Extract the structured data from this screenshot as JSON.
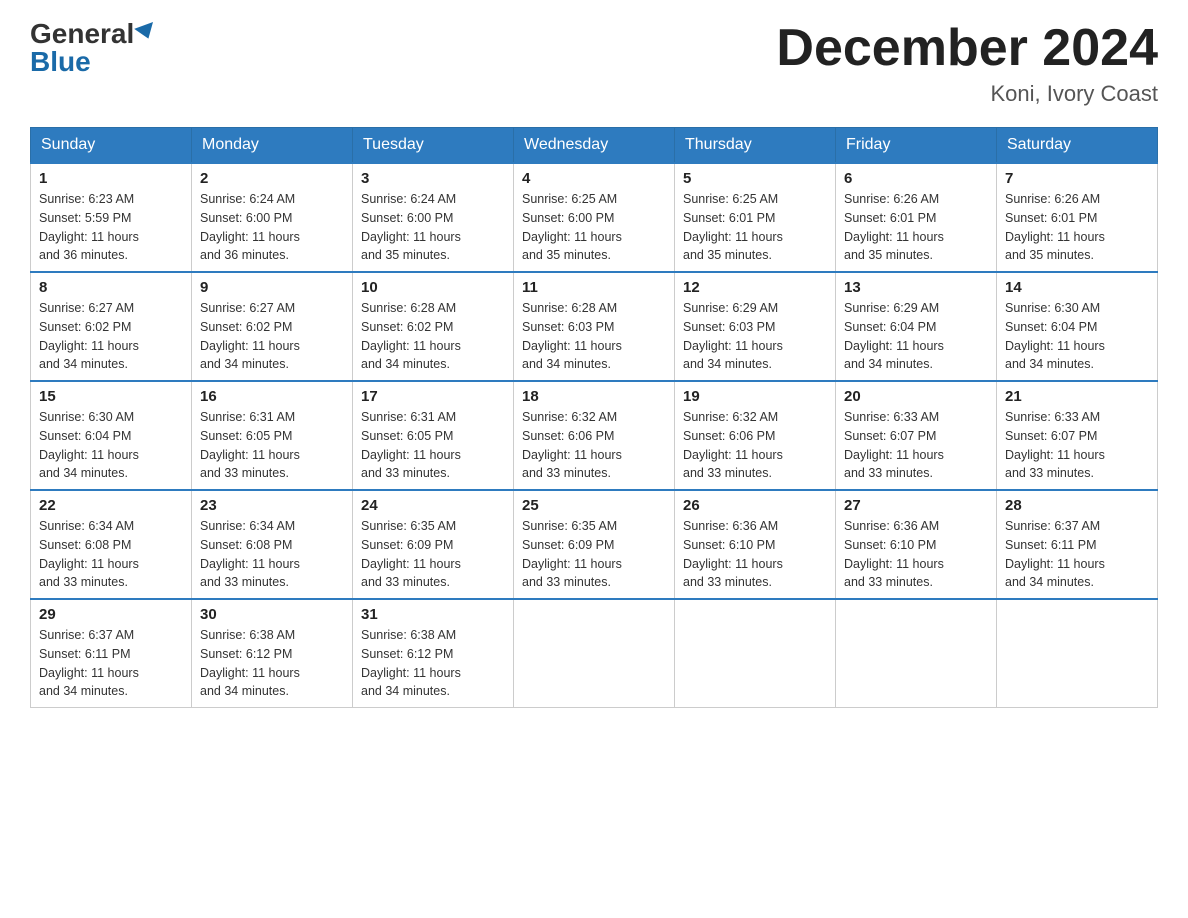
{
  "header": {
    "logo_general": "General",
    "logo_blue": "Blue",
    "month_title": "December 2024",
    "location": "Koni, Ivory Coast"
  },
  "days_of_week": [
    "Sunday",
    "Monday",
    "Tuesday",
    "Wednesday",
    "Thursday",
    "Friday",
    "Saturday"
  ],
  "weeks": [
    [
      {
        "day": 1,
        "sunrise": "6:23 AM",
        "sunset": "5:59 PM",
        "daylight": "11 hours and 36 minutes."
      },
      {
        "day": 2,
        "sunrise": "6:24 AM",
        "sunset": "6:00 PM",
        "daylight": "11 hours and 36 minutes."
      },
      {
        "day": 3,
        "sunrise": "6:24 AM",
        "sunset": "6:00 PM",
        "daylight": "11 hours and 35 minutes."
      },
      {
        "day": 4,
        "sunrise": "6:25 AM",
        "sunset": "6:00 PM",
        "daylight": "11 hours and 35 minutes."
      },
      {
        "day": 5,
        "sunrise": "6:25 AM",
        "sunset": "6:01 PM",
        "daylight": "11 hours and 35 minutes."
      },
      {
        "day": 6,
        "sunrise": "6:26 AM",
        "sunset": "6:01 PM",
        "daylight": "11 hours and 35 minutes."
      },
      {
        "day": 7,
        "sunrise": "6:26 AM",
        "sunset": "6:01 PM",
        "daylight": "11 hours and 35 minutes."
      }
    ],
    [
      {
        "day": 8,
        "sunrise": "6:27 AM",
        "sunset": "6:02 PM",
        "daylight": "11 hours and 34 minutes."
      },
      {
        "day": 9,
        "sunrise": "6:27 AM",
        "sunset": "6:02 PM",
        "daylight": "11 hours and 34 minutes."
      },
      {
        "day": 10,
        "sunrise": "6:28 AM",
        "sunset": "6:02 PM",
        "daylight": "11 hours and 34 minutes."
      },
      {
        "day": 11,
        "sunrise": "6:28 AM",
        "sunset": "6:03 PM",
        "daylight": "11 hours and 34 minutes."
      },
      {
        "day": 12,
        "sunrise": "6:29 AM",
        "sunset": "6:03 PM",
        "daylight": "11 hours and 34 minutes."
      },
      {
        "day": 13,
        "sunrise": "6:29 AM",
        "sunset": "6:04 PM",
        "daylight": "11 hours and 34 minutes."
      },
      {
        "day": 14,
        "sunrise": "6:30 AM",
        "sunset": "6:04 PM",
        "daylight": "11 hours and 34 minutes."
      }
    ],
    [
      {
        "day": 15,
        "sunrise": "6:30 AM",
        "sunset": "6:04 PM",
        "daylight": "11 hours and 34 minutes."
      },
      {
        "day": 16,
        "sunrise": "6:31 AM",
        "sunset": "6:05 PM",
        "daylight": "11 hours and 33 minutes."
      },
      {
        "day": 17,
        "sunrise": "6:31 AM",
        "sunset": "6:05 PM",
        "daylight": "11 hours and 33 minutes."
      },
      {
        "day": 18,
        "sunrise": "6:32 AM",
        "sunset": "6:06 PM",
        "daylight": "11 hours and 33 minutes."
      },
      {
        "day": 19,
        "sunrise": "6:32 AM",
        "sunset": "6:06 PM",
        "daylight": "11 hours and 33 minutes."
      },
      {
        "day": 20,
        "sunrise": "6:33 AM",
        "sunset": "6:07 PM",
        "daylight": "11 hours and 33 minutes."
      },
      {
        "day": 21,
        "sunrise": "6:33 AM",
        "sunset": "6:07 PM",
        "daylight": "11 hours and 33 minutes."
      }
    ],
    [
      {
        "day": 22,
        "sunrise": "6:34 AM",
        "sunset": "6:08 PM",
        "daylight": "11 hours and 33 minutes."
      },
      {
        "day": 23,
        "sunrise": "6:34 AM",
        "sunset": "6:08 PM",
        "daylight": "11 hours and 33 minutes."
      },
      {
        "day": 24,
        "sunrise": "6:35 AM",
        "sunset": "6:09 PM",
        "daylight": "11 hours and 33 minutes."
      },
      {
        "day": 25,
        "sunrise": "6:35 AM",
        "sunset": "6:09 PM",
        "daylight": "11 hours and 33 minutes."
      },
      {
        "day": 26,
        "sunrise": "6:36 AM",
        "sunset": "6:10 PM",
        "daylight": "11 hours and 33 minutes."
      },
      {
        "day": 27,
        "sunrise": "6:36 AM",
        "sunset": "6:10 PM",
        "daylight": "11 hours and 33 minutes."
      },
      {
        "day": 28,
        "sunrise": "6:37 AM",
        "sunset": "6:11 PM",
        "daylight": "11 hours and 34 minutes."
      }
    ],
    [
      {
        "day": 29,
        "sunrise": "6:37 AM",
        "sunset": "6:11 PM",
        "daylight": "11 hours and 34 minutes."
      },
      {
        "day": 30,
        "sunrise": "6:38 AM",
        "sunset": "6:12 PM",
        "daylight": "11 hours and 34 minutes."
      },
      {
        "day": 31,
        "sunrise": "6:38 AM",
        "sunset": "6:12 PM",
        "daylight": "11 hours and 34 minutes."
      },
      null,
      null,
      null,
      null
    ]
  ],
  "labels": {
    "sunrise": "Sunrise:",
    "sunset": "Sunset:",
    "daylight": "Daylight:"
  }
}
